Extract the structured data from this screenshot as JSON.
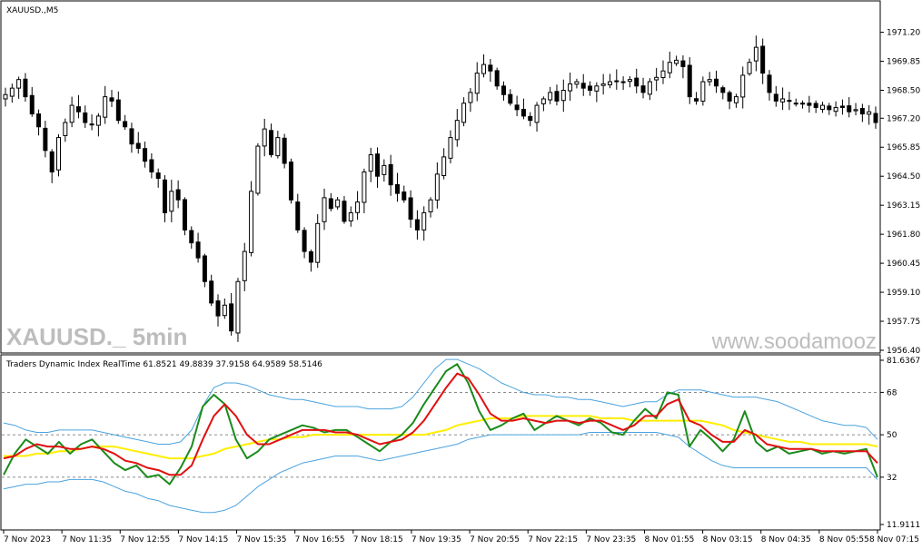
{
  "window": {
    "title": "XAUUSD.,M5",
    "watermark_left": "XAUUSD._ 5min",
    "watermark_right": "www.soodamooz"
  },
  "colors": {
    "candle": "#000000",
    "tdi_green": "#1a8a1a",
    "tdi_red": "#e01010",
    "tdi_yellow": "#ffee00",
    "tdi_band": "#4aa3df",
    "watermark": "#bdbdbd"
  },
  "chart_data": [
    {
      "type": "candlestick",
      "title": "XAUUSD.,M5",
      "ylim": [
        1956.4,
        1971.9
      ],
      "yticks": [
        "1971.20",
        "1969.85",
        "1968.50",
        "1967.20",
        "1965.85",
        "1964.50",
        "1963.15",
        "1961.80",
        "1960.45",
        "1959.10",
        "1957.75",
        "1956.40"
      ],
      "approx_close": [
        1968.3,
        1968.6,
        1969.0,
        1968.2,
        1967.4,
        1966.8,
        1965.7,
        1964.7,
        1966.3,
        1967.0,
        1967.8,
        1967.5,
        1967.0,
        1966.9,
        1967.3,
        1968.2,
        1968.0,
        1967.1,
        1966.8,
        1966.0,
        1965.8,
        1965.2,
        1964.7,
        1964.4,
        1962.8,
        1963.8,
        1963.4,
        1962.0,
        1961.4,
        1960.7,
        1959.6,
        1958.6,
        1958.0,
        1958.5,
        1957.3,
        1959.6,
        1961.0,
        1963.8,
        1965.9,
        1966.7,
        1965.5,
        1966.3,
        1965.1,
        1963.4,
        1962.0,
        1961.0,
        1960.5,
        1962.3,
        1963.5,
        1963.0,
        1963.4,
        1962.4,
        1962.8,
        1963.3,
        1964.7,
        1965.5,
        1964.5,
        1965.0,
        1964.1,
        1963.7,
        1963.4,
        1962.5,
        1962.0,
        1962.8,
        1963.4,
        1964.6,
        1965.4,
        1966.3,
        1967.1,
        1967.9,
        1968.4,
        1969.3,
        1969.7,
        1969.4,
        1968.7,
        1968.3,
        1967.9,
        1967.6,
        1967.3,
        1967.1,
        1967.8,
        1968.1,
        1968.4,
        1968.0,
        1968.5,
        1968.8,
        1968.9,
        1968.6,
        1968.5,
        1968.7,
        1968.8,
        1968.9,
        1968.9,
        1968.9,
        1969.0,
        1968.7,
        1968.4,
        1968.9,
        1969.1,
        1969.4,
        1969.8,
        1969.9,
        1969.6,
        1968.2,
        1968.0,
        1968.9,
        1969.0,
        1968.7,
        1968.4,
        1968.0,
        1968.2,
        1969.2,
        1969.8,
        1970.5,
        1969.3,
        1968.4,
        1968.0,
        1968.1,
        1968.0,
        1967.9,
        1967.9,
        1967.8,
        1967.7,
        1967.8,
        1967.6,
        1967.7,
        1967.7,
        1967.5,
        1967.6,
        1967.4,
        1967.5,
        1967.0
      ]
    },
    {
      "type": "line",
      "title": "Traders Dynamic Index RealTime 61.8521 49.8839 37.9158 64.9589 58.5146",
      "ylim": [
        11.9111,
        81.6367
      ],
      "levels": [
        32,
        50,
        68
      ],
      "ytick_labels": [
        "81.6367",
        "68",
        "50",
        "32",
        "11.9111"
      ],
      "x_labels": [
        "7 Nov 2023",
        "7 Nov 11:35",
        "7 Nov 12:55",
        "7 Nov 14:15",
        "7 Nov 15:35",
        "7 Nov 16:55",
        "7 Nov 18:15",
        "7 Nov 19:35",
        "7 Nov 20:55",
        "7 Nov 22:15",
        "7 Nov 23:35",
        "8 Nov 01:55",
        "8 Nov 03:15",
        "8 Nov 04:35",
        "8 Nov 05:55",
        "8 Nov 07:15"
      ],
      "series_values": {
        "green": [
          33,
          42,
          48,
          45,
          42,
          47,
          42,
          46,
          48,
          43,
          38,
          35,
          37,
          32,
          33,
          29,
          36,
          45,
          62,
          67,
          63,
          48,
          40,
          43,
          48,
          50,
          52,
          54,
          53,
          51,
          52,
          52,
          49,
          46,
          43,
          47,
          50,
          55,
          63,
          70,
          77,
          80,
          72,
          60,
          52,
          54,
          57,
          59,
          52,
          55,
          58,
          56,
          54,
          57,
          55,
          51,
          50,
          56,
          61,
          57,
          68,
          67,
          45,
          52,
          48,
          43,
          48,
          60,
          47,
          43,
          45,
          42,
          43,
          44,
          42,
          43,
          42,
          43,
          44,
          32
        ],
        "red": [
          40,
          41,
          44,
          46,
          45,
          45,
          44,
          44,
          45,
          44,
          42,
          39,
          38,
          36,
          35,
          33,
          33,
          37,
          48,
          58,
          63,
          58,
          50,
          46,
          46,
          48,
          50,
          52,
          52,
          52,
          51,
          51,
          50,
          48,
          46,
          47,
          48,
          51,
          56,
          63,
          70,
          76,
          74,
          67,
          59,
          56,
          56,
          57,
          56,
          55,
          56,
          56,
          55,
          56,
          56,
          54,
          52,
          54,
          58,
          58,
          63,
          65,
          56,
          54,
          50,
          47,
          47,
          52,
          50,
          46,
          45,
          44,
          44,
          44,
          43,
          43,
          43,
          43,
          43,
          38
        ],
        "yellow": [
          41,
          41,
          41,
          42,
          42,
          43,
          43,
          44,
          45,
          45,
          45,
          44,
          43,
          42,
          41,
          40,
          40,
          40,
          41,
          42,
          44,
          45,
          46,
          47,
          48,
          48,
          49,
          49,
          50,
          50,
          50,
          50,
          50,
          50,
          50,
          50,
          50,
          50,
          50,
          51,
          52,
          54,
          55,
          56,
          57,
          57,
          57,
          58,
          58,
          58,
          58,
          58,
          58,
          58,
          57,
          57,
          57,
          56,
          56,
          56,
          56,
          56,
          56,
          56,
          55,
          54,
          52,
          51,
          50,
          49,
          48,
          47,
          47,
          46,
          46,
          46,
          46,
          46,
          46,
          45
        ],
        "band_upper": [
          55,
          54,
          52,
          51,
          51,
          52,
          52,
          52,
          52,
          51,
          50,
          49,
          48,
          47,
          46,
          46,
          47,
          52,
          62,
          70,
          72,
          72,
          71,
          69,
          67,
          66,
          65,
          65,
          64,
          63,
          62,
          62,
          62,
          61,
          61,
          61,
          62,
          66,
          72,
          78,
          82,
          82,
          80,
          78,
          75,
          72,
          70,
          68,
          67,
          67,
          66,
          66,
          65,
          65,
          64,
          63,
          62,
          63,
          64,
          64,
          67,
          69,
          69,
          69,
          68,
          67,
          66,
          66,
          66,
          65,
          64,
          62,
          60,
          58,
          56,
          55,
          54,
          54,
          53,
          48
        ],
        "band_lower": [
          27,
          28,
          29,
          29,
          30,
          30,
          31,
          31,
          31,
          30,
          28,
          26,
          25,
          23,
          22,
          20,
          19,
          18,
          17,
          17,
          18,
          20,
          24,
          28,
          31,
          34,
          36,
          38,
          39,
          40,
          41,
          41,
          41,
          40,
          39,
          40,
          41,
          42,
          43,
          44,
          45,
          46,
          48,
          49,
          50,
          50,
          50,
          50,
          50,
          50,
          50,
          50,
          50,
          51,
          51,
          51,
          51,
          51,
          51,
          51,
          50,
          49,
          45,
          42,
          39,
          37,
          36,
          36,
          36,
          36,
          36,
          36,
          36,
          36,
          36,
          36,
          36,
          36,
          36,
          31
        ]
      }
    }
  ]
}
